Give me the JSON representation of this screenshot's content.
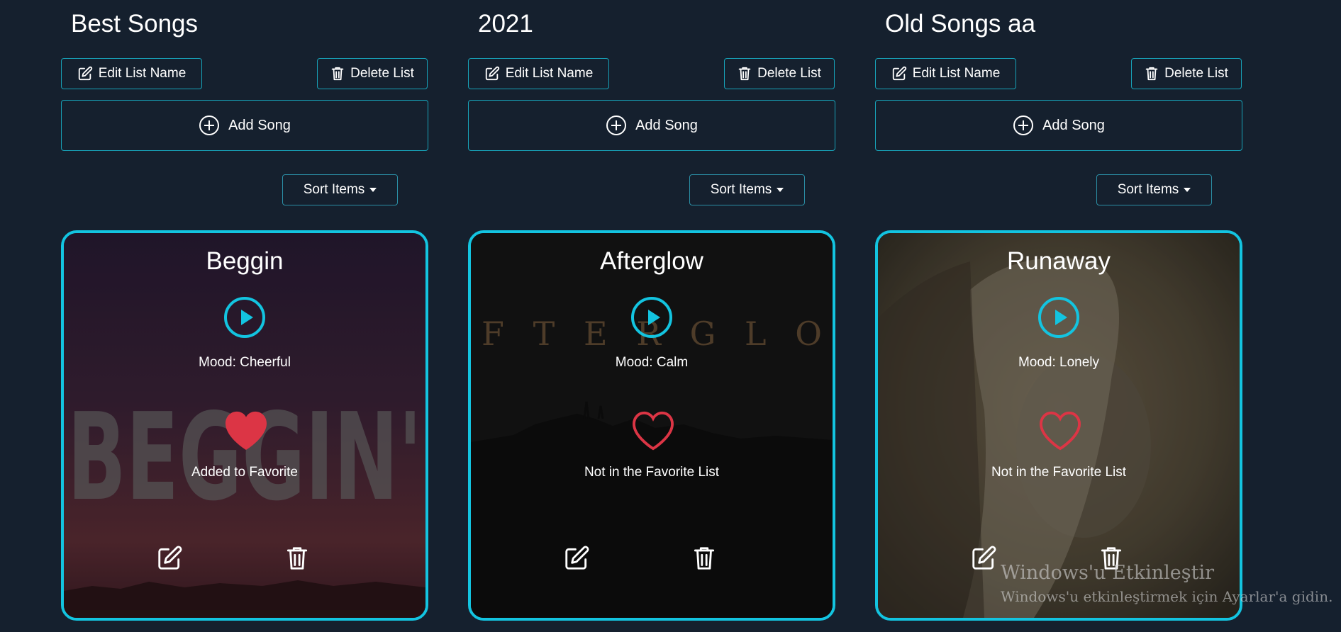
{
  "lists": [
    {
      "name": "Best Songs",
      "edit_label": "Edit List Name",
      "delete_label": "Delete List",
      "add_label": "Add Song",
      "sort_label": "Sort Items",
      "song": {
        "title": "Beggin",
        "mood": "Mood: Cheerful",
        "favorite": true,
        "favorite_text": "Added to Favorite",
        "cover_text": "BEGGIN'"
      }
    },
    {
      "name": "2021",
      "edit_label": "Edit List Name",
      "delete_label": "Delete List",
      "add_label": "Add Song",
      "sort_label": "Sort Items",
      "song": {
        "title": "Afterglow",
        "mood": "Mood: Calm",
        "favorite": false,
        "favorite_text": "Not in the Favorite List",
        "cover_text": "F T E R G L O"
      }
    },
    {
      "name": "Old Songs aa",
      "edit_label": "Edit List Name",
      "delete_label": "Delete List",
      "add_label": "Add Song",
      "sort_label": "Sort Items",
      "song": {
        "title": "Runaway",
        "mood": "Mood: Lonely",
        "favorite": false,
        "favorite_text": "Not in the Favorite List"
      }
    }
  ],
  "watermark": {
    "line1": "Windows'u Etkinleştir",
    "line2": "Windows'u etkinleştirmek için Ayarlar'a gidin."
  },
  "colors": {
    "background": "#15202e",
    "accent": "#13c4e0",
    "button_border": "#17a2b8",
    "heart": "#dc3545"
  },
  "icons": {
    "edit": "pencil-square-icon",
    "delete": "trash-icon",
    "add": "plus-circle-icon",
    "play": "play-icon",
    "favorite": "heart-icon"
  }
}
